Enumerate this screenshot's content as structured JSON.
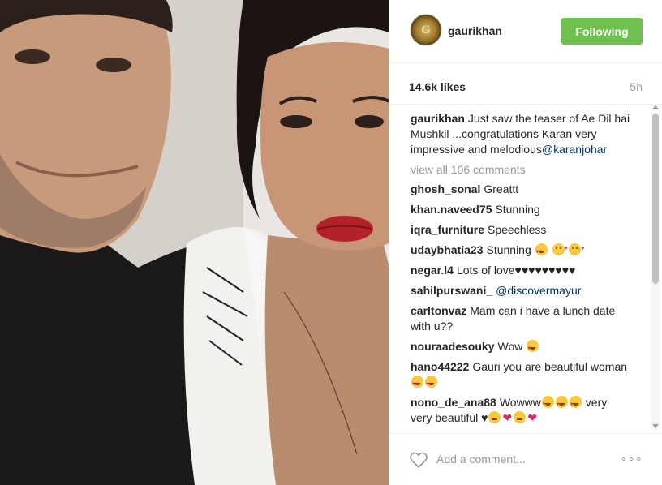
{
  "post": {
    "image_alt": "",
    "author": "gaurikhan",
    "avatar_letter": "G",
    "follow_label": "Following",
    "likes": "14.6k likes",
    "time": "5h",
    "view_all": "view all 106 comments",
    "add_comment_placeholder": "Add a comment...",
    "more_label": "∘∘∘"
  },
  "caption": {
    "user": "gaurikhan",
    "text": "Just saw the teaser of Ae Dil hai Mushkil ...congratulations Karan very impressive and melodious",
    "mention": "@karanjohar"
  },
  "comments": [
    {
      "user": "ghosh_sonal",
      "text": "Greattt"
    },
    {
      "user": "khan.naveed75",
      "text": "Stunning"
    },
    {
      "user": "iqra_furniture",
      "text": "Speechless"
    },
    {
      "user": "udaybhatia23",
      "text": "Stunning"
    },
    {
      "user": "negar.l4",
      "text": "Lots of love♥♥♥♥♥♥♥♥♥"
    },
    {
      "user": "sahilpurswani_",
      "text": "",
      "mention": "@discovermayur"
    },
    {
      "user": "carltonvaz",
      "text": "Mam can i have a lunch date with u??"
    },
    {
      "user": "nouraadesouky",
      "text": "Wow"
    },
    {
      "user": "hano44222",
      "text": "Gauri you are beautiful woman"
    },
    {
      "user": "nono_de_ana88",
      "text_a": "Wowww",
      "text_b": "very very beautiful ♥"
    }
  ],
  "colors": {
    "follow_bg": "#70c050",
    "mention": "#003569",
    "muted": "#999999",
    "text": "#262626"
  },
  "icons": {
    "heart": "heart-outline-icon",
    "more": "more-options-icon",
    "scroll_up": "scroll-up-arrow-icon",
    "scroll_down": "scroll-down-arrow-icon"
  }
}
